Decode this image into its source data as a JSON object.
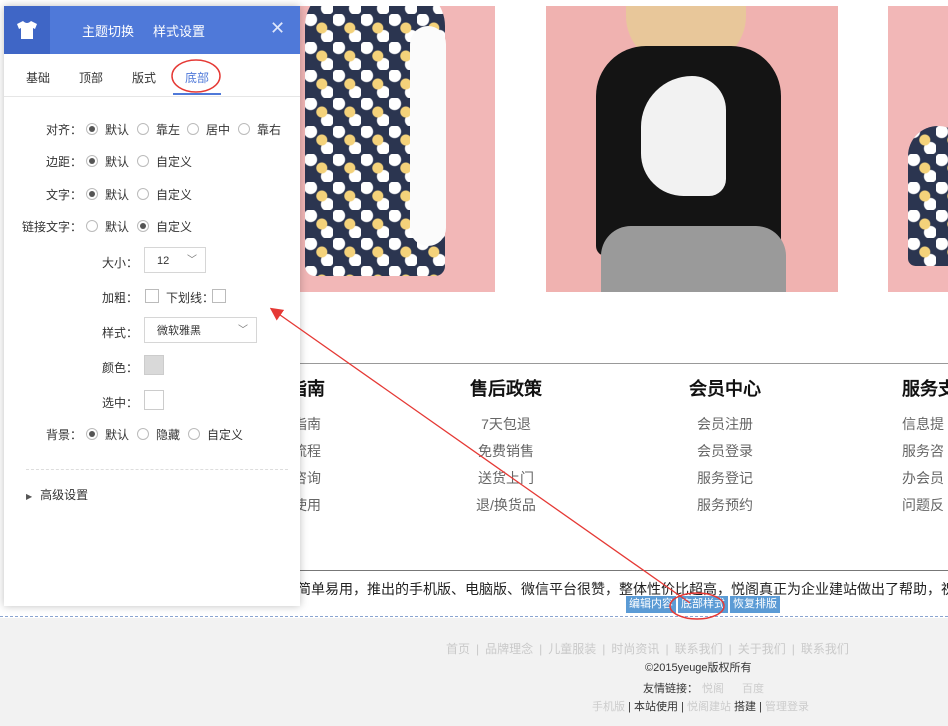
{
  "panel": {
    "header_tabs": [
      "主题切换",
      "样式设置"
    ],
    "subtabs": [
      "基础",
      "顶部",
      "版式",
      "底部"
    ],
    "active_subtab": "底部",
    "rows": {
      "align": {
        "label": "对齐：",
        "options": [
          "默认",
          "靠左",
          "居中",
          "靠右"
        ],
        "selected": 0
      },
      "margin": {
        "label": "边距：",
        "options": [
          "默认",
          "自定义"
        ],
        "selected": 0
      },
      "text": {
        "label": "文字：",
        "options": [
          "默认",
          "自定义"
        ],
        "selected": 0
      },
      "link_text": {
        "label": "链接文字：",
        "options": [
          "默认",
          "自定义"
        ],
        "selected": 1
      },
      "size": {
        "label": "大小：",
        "value": "12"
      },
      "bold": {
        "label": "加粗："
      },
      "underline": {
        "label": "下划线："
      },
      "style": {
        "label": "样式：",
        "value": "微软雅黑"
      },
      "color": {
        "label": "颜色：",
        "swatch": "#d9d9d9"
      },
      "selected_color": {
        "label": "选中：",
        "swatch": "#ffffff"
      },
      "background": {
        "label": "背景：",
        "options": [
          "默认",
          "隐藏",
          "自定义"
        ],
        "selected": 0
      }
    },
    "advanced": "高级设置"
  },
  "site": {
    "footer_columns": [
      {
        "title": "指南",
        "items": [
          "指南",
          "流程",
          "咨询",
          "使用"
        ]
      },
      {
        "title": "售后政策",
        "items": [
          "7天包退",
          "免费销售",
          "送货上门",
          "退/换货品"
        ]
      },
      {
        "title": "会员中心",
        "items": [
          "会员注册",
          "会员登录",
          "服务登记",
          "服务预约"
        ]
      },
      {
        "title": "服务支",
        "items": [
          "信息提",
          "服务咨",
          "办会员",
          "问题反"
        ]
      }
    ],
    "marquee": "简单易用，推出的手机版、电脑版、微信平台很赞，整体性价比超高，悦阁真正为企业建站做出了帮助，祝做",
    "edit_buttons": [
      "编辑内容",
      "底部样式",
      "恢复排版"
    ],
    "nav_links": [
      "首页",
      "品牌理念",
      "儿童服装",
      "时尚资讯",
      "联系我们",
      "关于我们",
      "联系我们"
    ],
    "copyright": "©2015yeuge版权所有",
    "friend_label": "友情链接：",
    "friend_links": [
      "悦阁",
      "百度"
    ],
    "site_links": [
      "手机版",
      "本站使用",
      "悦阁建站",
      "搭建",
      "管理登录"
    ]
  },
  "colors": {
    "accent": "#4f79d9",
    "annotation": "#e53935",
    "edit_bar": "#5b9bd5"
  }
}
